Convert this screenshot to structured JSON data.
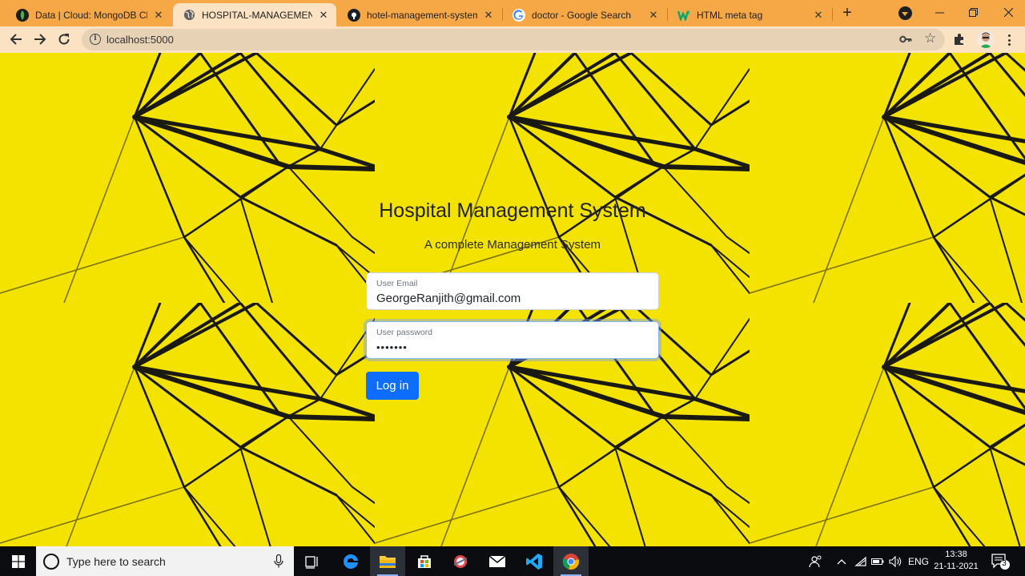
{
  "browser": {
    "tabs": [
      {
        "title": "Data | Cloud: MongoDB Cloud",
        "icon": "mongodb-leaf-icon",
        "active": false
      },
      {
        "title": "HOSPITAL-MANAGEMENT",
        "icon": "globe-icon",
        "active": true
      },
      {
        "title": "hotel-management-system/p",
        "icon": "github-icon",
        "active": false
      },
      {
        "title": "doctor - Google Search",
        "icon": "google-icon",
        "active": false
      },
      {
        "title": "HTML meta tag",
        "icon": "w3schools-icon",
        "active": false
      }
    ],
    "new_tab_label": "+",
    "url": "localhost:5000",
    "colors": {
      "tabstrip": "#f6a847",
      "toolbar": "#fbe2c2",
      "omnibox": "#e8d2b6"
    }
  },
  "page": {
    "heading": "Hospital Management System",
    "subheading": "A complete Management System",
    "email": {
      "label": "User Email",
      "value": "GeorgeRanjith@gmail.com"
    },
    "password": {
      "label": "User password",
      "value": "•••••••"
    },
    "login_label": "Log in",
    "colors": {
      "background": "#f4e200",
      "button": "#0d6efd"
    }
  },
  "taskbar": {
    "search_placeholder": "Type here to search",
    "apps": [
      "task-view-icon",
      "edge-icon",
      "file-explorer-icon",
      "store-icon",
      "snip-icon",
      "mail-icon",
      "vscode-icon",
      "chrome-icon"
    ],
    "language": "ENG",
    "time": "13:38",
    "date": "21-11-2021",
    "notification_count": "3"
  }
}
